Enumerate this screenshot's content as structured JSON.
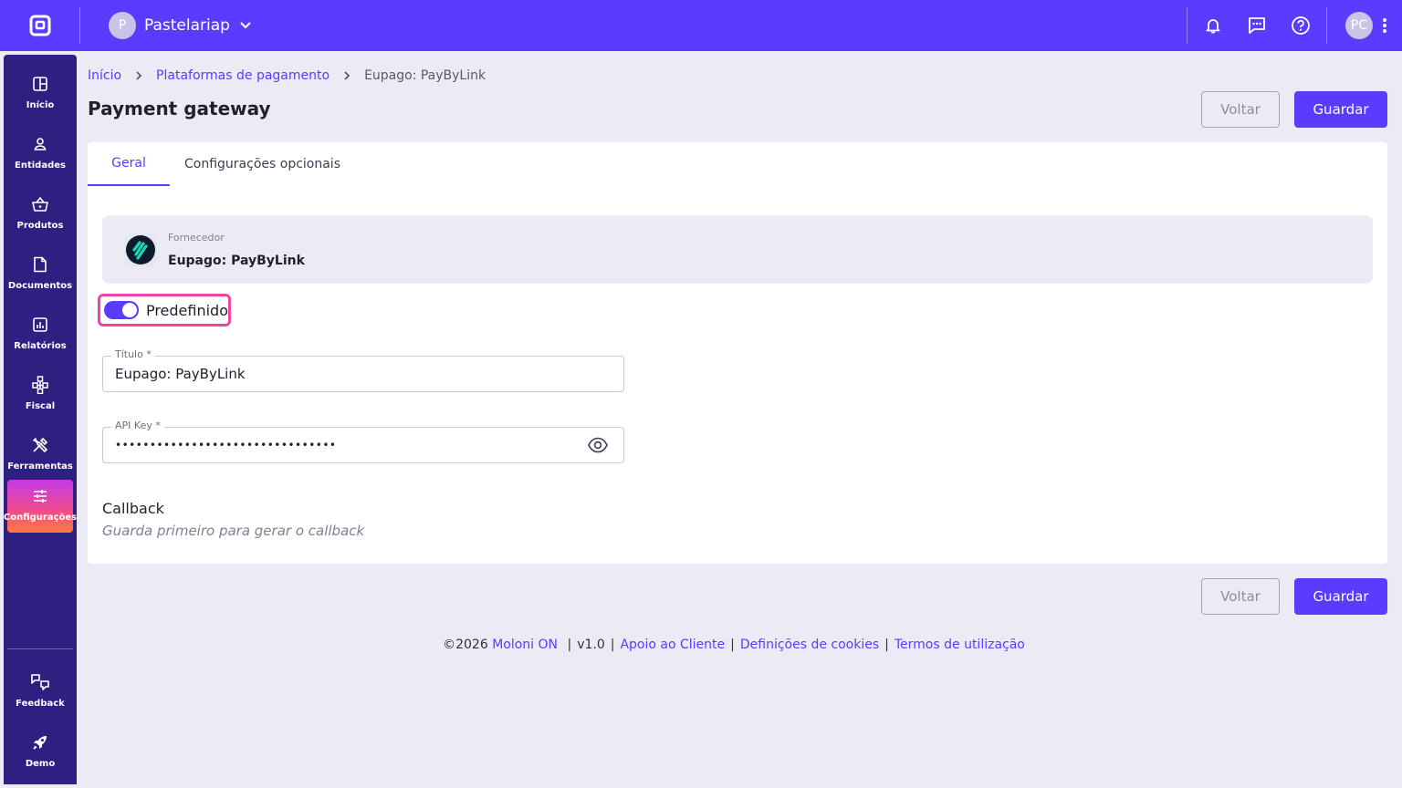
{
  "topbar": {
    "company_initial": "P",
    "company_name": "Pastelariap",
    "user_initials": "PC",
    "icons": [
      "app-logo-icon",
      "chevron-down-icon",
      "bell-icon",
      "chat-icon",
      "help-icon",
      "more-vert-icon"
    ]
  },
  "sidebar": {
    "items": [
      {
        "label": "Início",
        "icon": "dashboard-icon"
      },
      {
        "label": "Entidades",
        "icon": "user-icon"
      },
      {
        "label": "Produtos",
        "icon": "basket-icon"
      },
      {
        "label": "Documentos",
        "icon": "document-icon"
      },
      {
        "label": "Relatórios",
        "icon": "chart-icon"
      },
      {
        "label": "Fiscal",
        "icon": "network-icon"
      },
      {
        "label": "Ferramentas",
        "icon": "tools-icon"
      },
      {
        "label": "Configurações",
        "icon": "sliders-icon",
        "active": true
      },
      {
        "label": "Feedback",
        "icon": "feedback-icon"
      },
      {
        "label": "Demo",
        "icon": "rocket-icon"
      }
    ]
  },
  "breadcrumb": {
    "home": "Início",
    "section": "Plataformas de pagamento",
    "current": "Eupago: PayByLink"
  },
  "page": {
    "title": "Payment gateway",
    "back_label": "Voltar",
    "save_label": "Guardar"
  },
  "tabs": [
    "Geral",
    "Configurações opcionais"
  ],
  "provider": {
    "label": "Fornecedor",
    "name": "Eupago: PayByLink"
  },
  "default_toggle": {
    "label": "Predefinido",
    "on": true
  },
  "form": {
    "title_label": "Título *",
    "title_value": "Eupago: PayByLink",
    "apikey_label": "API Key *",
    "apikey_value": "••••••••••••••••••••••••••••••••"
  },
  "callback": {
    "title": "Callback",
    "hint": "Guarda primeiro para gerar o callback"
  },
  "footer": {
    "copyright": "©2026",
    "brand": "Moloni ON",
    "version": "v1.0",
    "support": "Apoio ao Cliente",
    "cookies": "Definições de cookies",
    "terms": "Termos de utilização"
  },
  "colors": {
    "primary": "#5b3bff",
    "sidebar": "#2e2080",
    "highlight": "#f044a8"
  }
}
